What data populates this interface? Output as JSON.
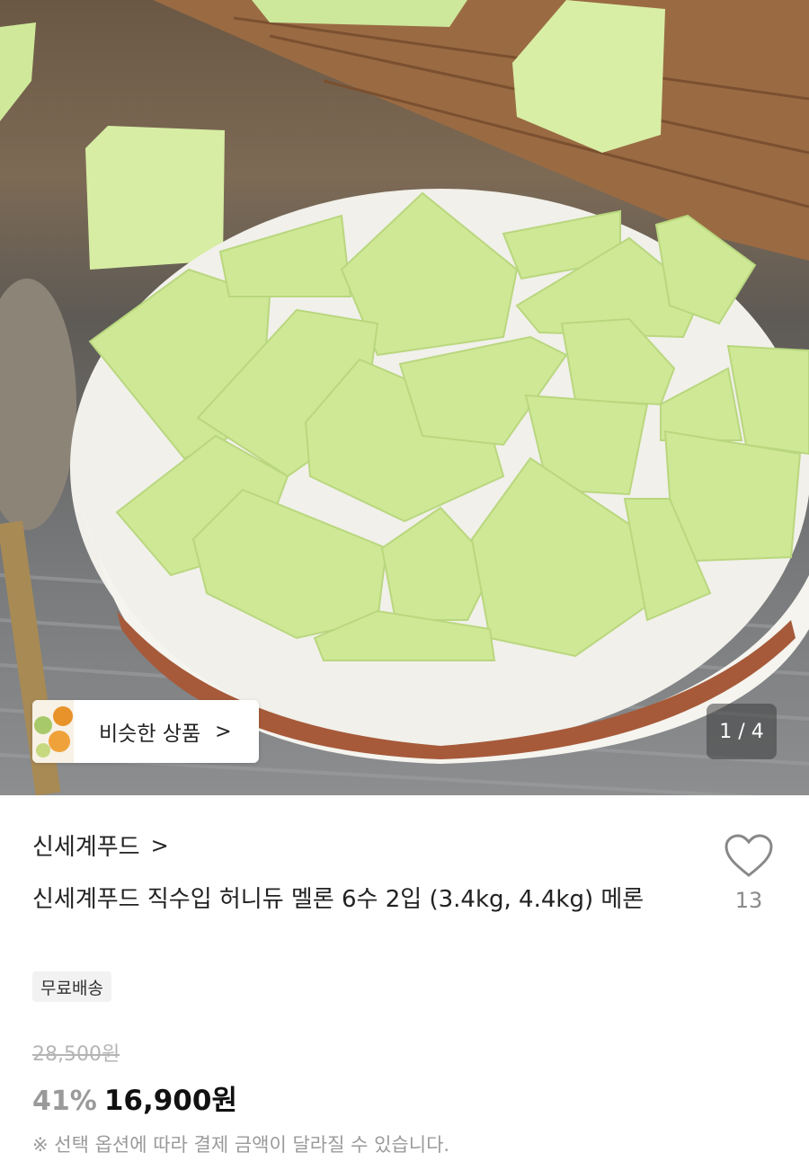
{
  "gallery": {
    "counter": "1 / 4",
    "similar_label": "비슷한 상품",
    "similar_chevron": ">"
  },
  "seller": {
    "name": "신세계푸드",
    "chevron": ">"
  },
  "product": {
    "title": "신세계푸드 직수입 허니듀 멜론 6수 2입 (3.4kg, 4.4kg) 메론",
    "like_count": "13",
    "badge": "무료배송",
    "original_price": "28,500원",
    "discount": "41%",
    "price": "16,900원",
    "notice": "※ 선택 옵션에 따라 결제 금액이 달라질 수 있습니다."
  },
  "icons": {
    "heart": "heart-icon",
    "chevron": "chevron-right-icon"
  }
}
